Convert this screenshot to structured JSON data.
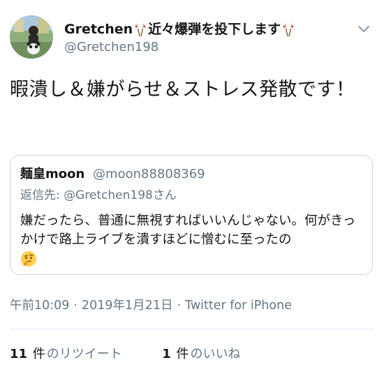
{
  "author": {
    "name": "Gretchen",
    "name_suffix": "近々爆弾を投下します",
    "handle": "@Gretchen198",
    "avatar_icon": "avatar-photo",
    "flag_icon": "crossed-flags-icon"
  },
  "menu": {
    "icon": "chevron-down-icon"
  },
  "tweet": {
    "text": "暇潰し＆嫌がらせ＆ストレス発散です！"
  },
  "quote": {
    "author_name": "麺皇moon",
    "author_handle": "@moon88808369",
    "reply_prefix": "返信先: ",
    "reply_handle": "@Gretchen198さん",
    "text": "嫌だったら、普通に無視すればいいんじゃない。何がきっかけで路上ライブを潰すほどに憎むに至ったの",
    "emoji_icon": "thinking-face-icon"
  },
  "meta": {
    "time": "午前10:09",
    "separator": "·",
    "date": "2019年1月21日",
    "source": "Twitter for iPhone"
  },
  "stats": {
    "retweets_count": "11",
    "retweets_unit": "件",
    "retweets_label": "のリツイート",
    "likes_count": "1",
    "likes_unit": "件",
    "likes_label": "のいいね"
  },
  "colors": {
    "text": "#14171a",
    "secondary": "#657786",
    "border": "#ccd6dd",
    "divider": "#e1e8ed"
  }
}
